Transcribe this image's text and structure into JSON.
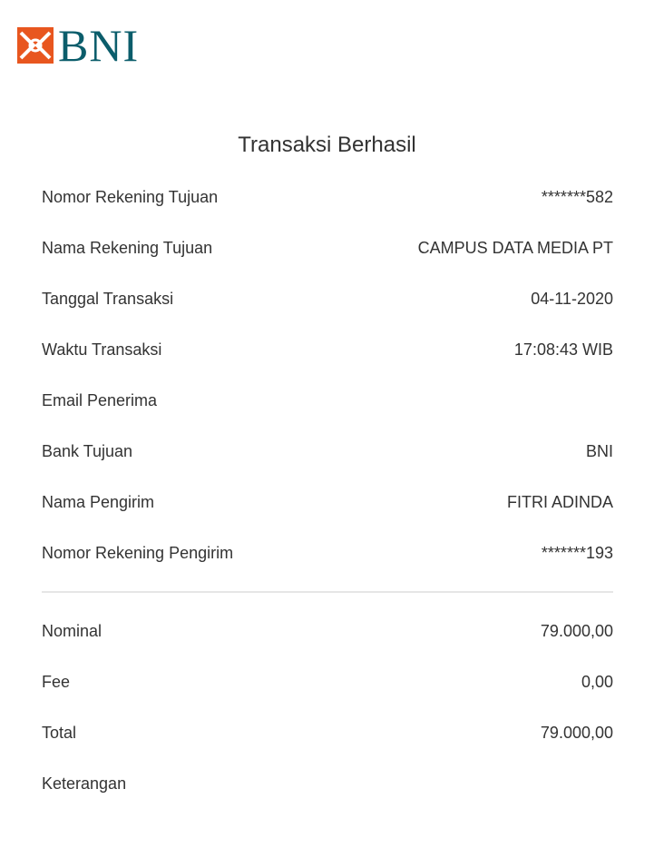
{
  "brand": {
    "name": "BNI",
    "mark_color": "#e8561f",
    "text_color": "#0b5d6b"
  },
  "title": "Transaksi Berhasil",
  "details": [
    {
      "label": "Nomor Rekening Tujuan",
      "value": "*******582"
    },
    {
      "label": "Nama Rekening Tujuan",
      "value": "CAMPUS DATA MEDIA PT"
    },
    {
      "label": "Tanggal Transaksi",
      "value": "04-11-2020"
    },
    {
      "label": "Waktu Transaksi",
      "value": "17:08:43 WIB"
    },
    {
      "label": "Email Penerima",
      "value": ""
    },
    {
      "label": "Bank Tujuan",
      "value": "BNI"
    },
    {
      "label": "Nama Pengirim",
      "value": "FITRI ADINDA"
    },
    {
      "label": "Nomor Rekening Pengirim",
      "value": "*******193"
    }
  ],
  "amounts": [
    {
      "label": "Nominal",
      "value": "79.000,00"
    },
    {
      "label": "Fee",
      "value": "0,00"
    },
    {
      "label": "Total",
      "value": "79.000,00"
    },
    {
      "label": "Keterangan",
      "value": ""
    }
  ]
}
